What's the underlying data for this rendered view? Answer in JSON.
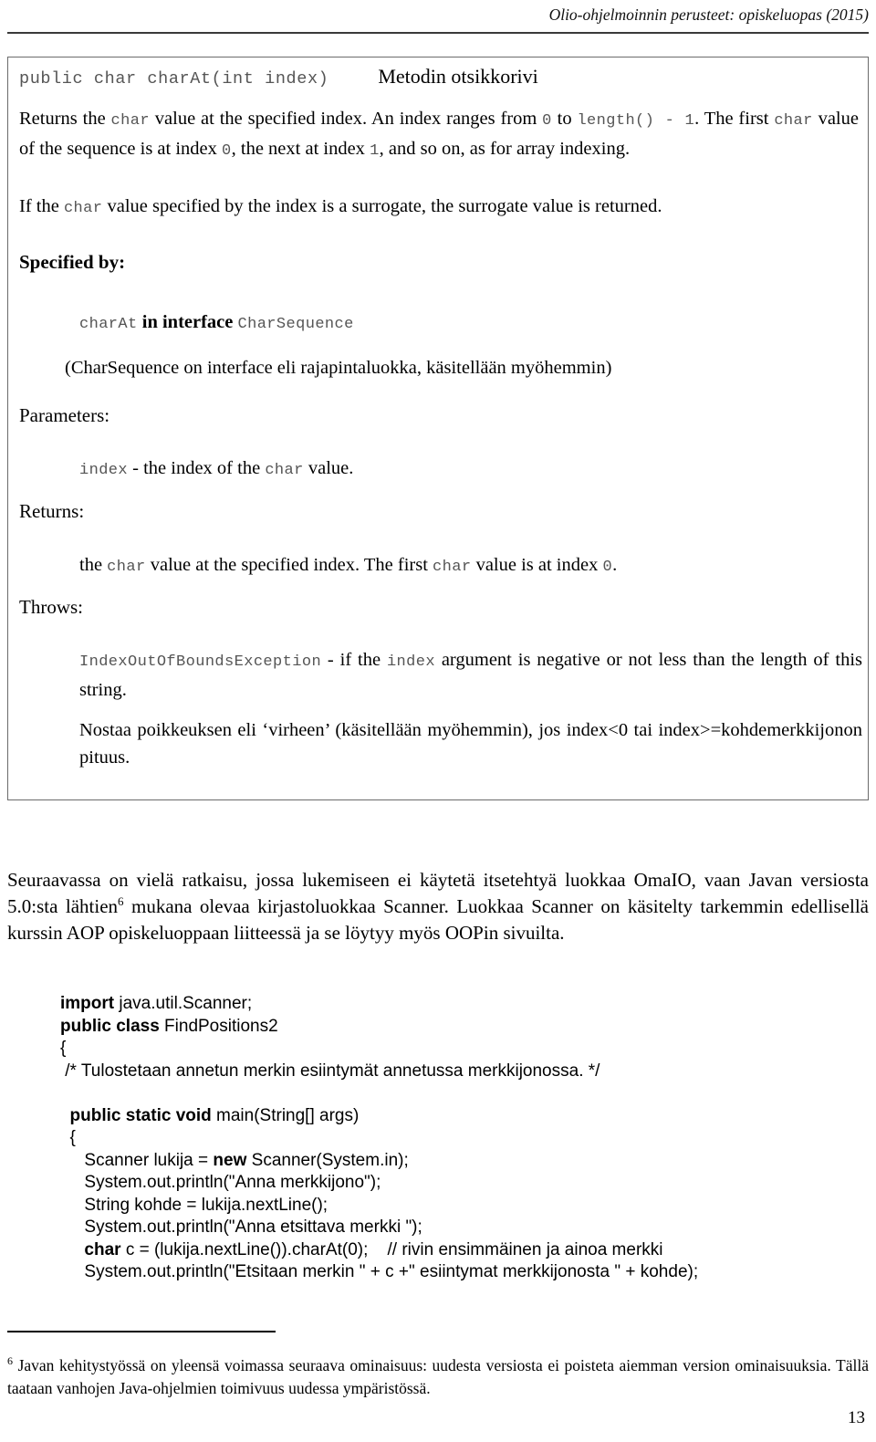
{
  "header": {
    "running_title": "Olio-ohjelmoinnin perusteet: opiskeluopas (2015)"
  },
  "javadoc_box": {
    "signature": "public char charAt(int index)",
    "signature_annotation": "Metodin otsikkorivi",
    "description_1": {
      "t1": "Returns the ",
      "c1": "char",
      "t2": " value at the specified index. An index ranges from ",
      "c2": "0",
      "t3": " to ",
      "c3": "length() - 1",
      "t4": ". The first ",
      "c4": "char",
      "t5": " value of the sequence is at index ",
      "c5": "0",
      "t6": ", the next at index ",
      "c6": "1",
      "t7": ", and so on, as for array indexing."
    },
    "description_2": {
      "t1": "If the ",
      "c1": "char",
      "t2": " value specified by the index is a surrogate, the surrogate value is returned."
    },
    "specified_by_label": "Specified by:",
    "specified_by": {
      "method": "charAt",
      "connector": "in interface",
      "interface": "CharSequence"
    },
    "specified_by_note": "(CharSequence on interface eli rajapintaluokka, käsitellään myöhemmin)",
    "parameters_label": "Parameters:",
    "parameters": {
      "name": "index",
      "t1": " - the index of the ",
      "c1": "char",
      "t2": " value."
    },
    "returns_label": "Returns:",
    "returns": {
      "t1": "the ",
      "c1": "char",
      "t2": " value at the specified index. The first ",
      "c2": "char",
      "t3": " value is at index ",
      "c3": "0",
      "t4": "."
    },
    "throws_label": "Throws:",
    "throws": {
      "exception": "IndexOutOfBoundsException",
      "t1": " - if the ",
      "c1": "index",
      "t2": " argument is negative or not less than the length of this string."
    },
    "throws_note": "Nostaa poikkeuksen eli ‘virheen’ (käsitellään myöhemmin), jos index<0 tai index>=kohdemerkkijonon pituus."
  },
  "prose": {
    "t1": "Seuraavassa on vielä ratkaisu, jossa lukemiseen ei käytetä itsetehtyä luokkaa OmaIO, vaan Javan versiosta 5.0:sta lähtien",
    "footnote_marker": "6",
    "t2": " mukana olevaa kirjastoluokkaa Scanner. Luokkaa Scanner on käsitelty tarkemmin edellisellä kurssin AOP opiskeluoppaan liitteessä ja se löytyy myös OOPin sivuilta."
  },
  "code": {
    "lines": [
      {
        "kw": "import ",
        "rest": "java.util.Scanner;"
      },
      {
        "kw": "public class ",
        "rest": "FindPositions2"
      },
      {
        "kw": "",
        "rest": "{"
      },
      {
        "kw": "",
        "rest": " /* Tulostetaan annetun merkin esiintymät annetussa merkkijonossa. */"
      },
      {
        "kw": "",
        "rest": ""
      },
      {
        "kw": "  public static void ",
        "rest": "main(String[] args)"
      },
      {
        "kw": "",
        "rest": "  {"
      },
      {
        "kw": "",
        "rest": "     Scanner lukija = ",
        "kw2": "new ",
        "rest2": "Scanner(System.in);"
      },
      {
        "kw": "",
        "rest": "     System.out.println(\"Anna merkkijono\");"
      },
      {
        "kw": "",
        "rest": "     String kohde = lukija.nextLine();"
      },
      {
        "kw": "",
        "rest": "     System.out.println(\"Anna etsittava merkki \");"
      },
      {
        "kw": "     char ",
        "rest": "c = (lukija.nextLine()).charAt(0);    // rivin ensimmäinen ja ainoa merkki"
      },
      {
        "kw": "",
        "rest": "     System.out.println(\"Etsitaan merkin \" + c +\" esiintymat merkkijonosta \" + kohde);"
      }
    ]
  },
  "footnote": {
    "marker": "6",
    "text": " Javan kehitystyössä on yleensä voimassa seuraava ominaisuus: uudesta versiosta ei poisteta aiemman version ominaisuuksia.  Tällä taataan vanhojen Java-ohjelmien toimivuus uudessa ympäristössä."
  },
  "page_number": "13"
}
